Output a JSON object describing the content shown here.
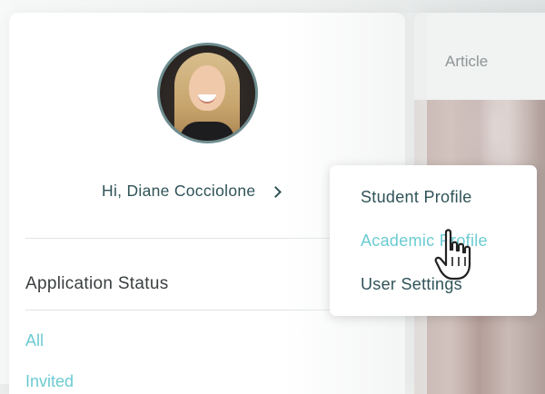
{
  "article": {
    "label": "Article"
  },
  "profile": {
    "greeting": "Hi, Diane Cocciolone",
    "section_title": "Application Status",
    "status_filters": [
      "All",
      "Invited"
    ]
  },
  "menu": {
    "items": [
      "Student Profile",
      "Academic Profile",
      "User Settings"
    ],
    "hovered_index": 1
  },
  "colors": {
    "accent": "#6bcbd2",
    "primary_text": "#2f5358",
    "avatar_border": "#6f8d91"
  },
  "icons": [
    "chevron-right-icon",
    "hand-pointer-cursor-icon"
  ]
}
